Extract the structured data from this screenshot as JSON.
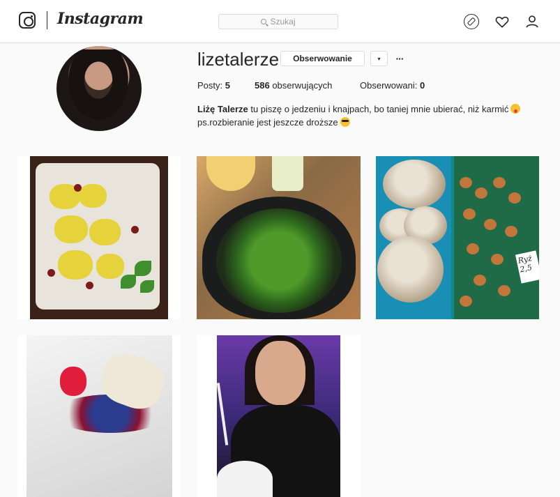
{
  "nav": {
    "brand": "Instagram",
    "search_placeholder": "Szukaj"
  },
  "profile": {
    "username": "lizetalerze",
    "follow_label": "Obserwowanie",
    "dropdown_glyph": "▾",
    "more_glyph": "···",
    "stats": {
      "posts_label": "Posty:",
      "posts_value": "5",
      "followers_value": "586",
      "followers_label": "obserwujących",
      "following_label": "Obserwowani:",
      "following_value": "0"
    },
    "bio": {
      "name": "Liżę Talerze",
      "line1": " tu piszę o jedzeniu i knajpach, bo taniej mnie ubierać, niż karmić",
      "line2": "ps.rozbieranie jest jeszcze droższe"
    }
  },
  "posts": {
    "mushroom_sign_text": "Ryż 2,5"
  },
  "icons": [
    "instagram-icon",
    "search-icon",
    "compass-icon",
    "heart-icon",
    "person-icon",
    "dropdown-icon",
    "more-icon"
  ],
  "colors": {
    "background": "#fafafa",
    "border": "#dbdbdb",
    "text": "#262626"
  }
}
